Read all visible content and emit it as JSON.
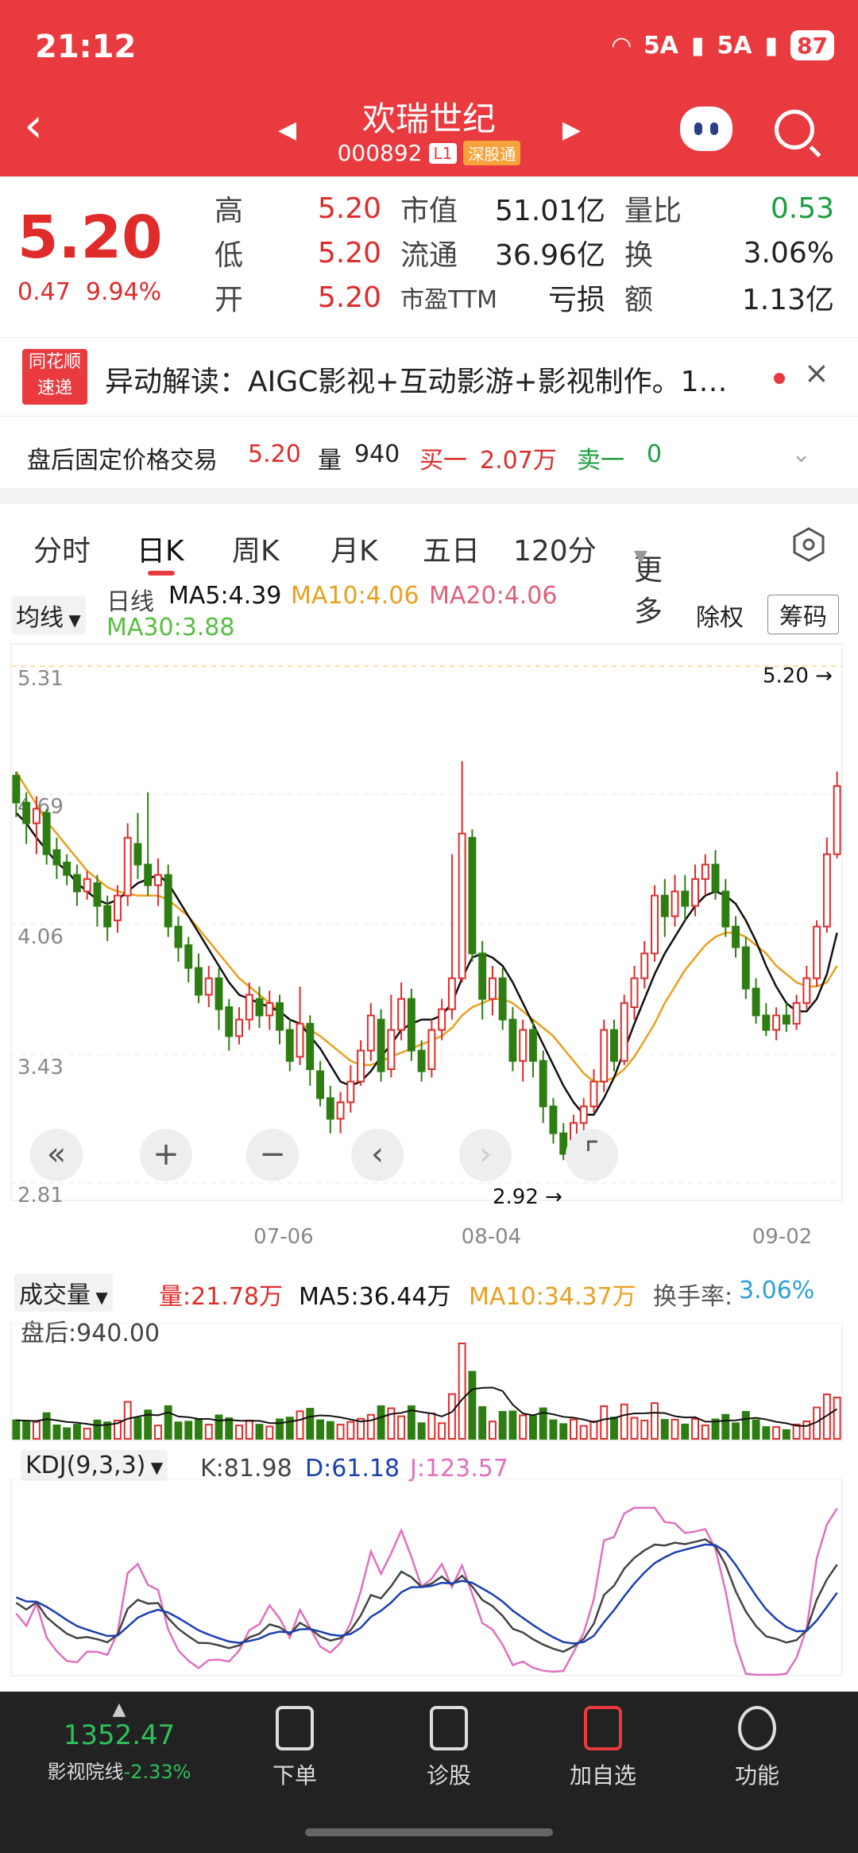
{
  "status": {
    "time": "21:12",
    "network": "5A",
    "battery": "87"
  },
  "header": {
    "name": "欢瑞世纪",
    "code": "000892",
    "level": "L1",
    "market_tag": "深股通"
  },
  "quote": {
    "price": "5.20",
    "change": "0.47",
    "change_pct": "9.94%",
    "rows": [
      [
        {
          "l": "高",
          "v": "5.20",
          "c": "red"
        },
        {
          "l": "市值",
          "v": "51.01亿"
        },
        {
          "l": "量比",
          "v": "0.53",
          "c": "green"
        }
      ],
      [
        {
          "l": "低",
          "v": "5.20",
          "c": "red"
        },
        {
          "l": "流通",
          "v": "36.96亿"
        },
        {
          "l": "换",
          "v": "3.06%"
        }
      ],
      [
        {
          "l": "开",
          "v": "5.20",
          "c": "red"
        },
        {
          "l": "市盈TTM",
          "v": "亏损"
        },
        {
          "l": "额",
          "v": "1.13亿"
        }
      ]
    ]
  },
  "banner": {
    "logo_top": "同花顺",
    "logo_bottom": "速递",
    "text": "异动解读：AIGC影视+互动影游+影视制作。1…"
  },
  "after_hours": {
    "label": "盘后固定价格交易",
    "price": "5.20",
    "vol_label": "量",
    "vol": "940",
    "buy_label": "买一",
    "buy": "2.07万",
    "sell_label": "卖一",
    "sell": "0"
  },
  "tabs": [
    "分时",
    "日K",
    "周K",
    "月K",
    "五日",
    "120分",
    "更多"
  ],
  "chart_header": {
    "ma_select": "均线",
    "period": "日线",
    "ma5": "MA5:4.39",
    "ma10": "MA10:4.06",
    "ma20": "MA20:4.06",
    "ma30": "MA30:3.88",
    "fq": "除权",
    "chips": "筹码"
  },
  "colors": {
    "up": "#e02b2b",
    "down": "#2e7d12",
    "ma5": "#111111",
    "ma10": "#e8a020",
    "ma20": "#e0607a",
    "ma30": "#55c040"
  },
  "chart_data": {
    "type": "candlestick",
    "y_ticks": [
      "5.31",
      "4.69",
      "4.06",
      "3.43",
      "2.81"
    ],
    "ylim": [
      2.81,
      5.31
    ],
    "x_ticks": [
      "07-06",
      "08-04",
      "09-02"
    ],
    "annotations": {
      "high_label": "5.20",
      "low_label": "2.92"
    },
    "candles": [
      [
        4.78,
        4.65,
        4.8,
        4.58
      ],
      [
        4.65,
        4.55,
        4.7,
        4.45
      ],
      [
        4.55,
        4.62,
        4.68,
        4.4
      ],
      [
        4.6,
        4.4,
        4.62,
        4.35
      ],
      [
        4.42,
        4.35,
        4.48,
        4.28
      ],
      [
        4.36,
        4.3,
        4.4,
        4.25
      ],
      [
        4.3,
        4.22,
        4.35,
        4.15
      ],
      [
        4.22,
        4.28,
        4.32,
        4.18
      ],
      [
        4.26,
        4.15,
        4.3,
        4.05
      ],
      [
        4.15,
        4.05,
        4.2,
        3.98
      ],
      [
        4.08,
        4.2,
        4.25,
        4.02
      ],
      [
        4.2,
        4.48,
        4.55,
        4.15
      ],
      [
        4.45,
        4.35,
        4.6,
        4.28
      ],
      [
        4.35,
        4.25,
        4.7,
        4.2
      ],
      [
        4.25,
        4.3,
        4.38,
        4.15
      ],
      [
        4.3,
        4.05,
        4.35,
        4.0
      ],
      [
        4.05,
        3.95,
        4.1,
        3.88
      ],
      [
        3.96,
        3.85,
        4.0,
        3.78
      ],
      [
        3.85,
        3.72,
        3.92,
        3.68
      ],
      [
        3.72,
        3.8,
        3.86,
        3.66
      ],
      [
        3.8,
        3.65,
        3.85,
        3.55
      ],
      [
        3.66,
        3.52,
        3.7,
        3.45
      ],
      [
        3.52,
        3.6,
        3.66,
        3.48
      ],
      [
        3.6,
        3.72,
        3.78,
        3.55
      ],
      [
        3.7,
        3.62,
        3.76,
        3.56
      ],
      [
        3.62,
        3.68,
        3.74,
        3.55
      ],
      [
        3.68,
        3.55,
        3.72,
        3.48
      ],
      [
        3.55,
        3.4,
        3.6,
        3.35
      ],
      [
        3.42,
        3.58,
        3.76,
        3.38
      ],
      [
        3.58,
        3.36,
        3.62,
        3.28
      ],
      [
        3.35,
        3.22,
        3.4,
        3.18
      ],
      [
        3.22,
        3.12,
        3.28,
        3.05
      ],
      [
        3.12,
        3.2,
        3.25,
        3.05
      ],
      [
        3.2,
        3.3,
        3.38,
        3.15
      ],
      [
        3.3,
        3.45,
        3.5,
        3.28
      ],
      [
        3.45,
        3.62,
        3.68,
        3.4
      ],
      [
        3.6,
        3.35,
        3.65,
        3.3
      ],
      [
        3.36,
        3.55,
        3.72,
        3.32
      ],
      [
        3.55,
        3.7,
        3.78,
        3.5
      ],
      [
        3.7,
        3.45,
        3.75,
        3.4
      ],
      [
        3.45,
        3.35,
        3.5,
        3.3
      ],
      [
        3.36,
        3.55,
        3.6,
        3.32
      ],
      [
        3.55,
        3.65,
        3.7,
        3.5
      ],
      [
        3.65,
        3.8,
        4.4,
        3.6
      ],
      [
        3.8,
        4.5,
        4.85,
        3.78
      ],
      [
        4.48,
        3.92,
        4.52,
        3.88
      ],
      [
        3.92,
        3.7,
        3.98,
        3.6
      ],
      [
        3.7,
        3.8,
        3.86,
        3.62
      ],
      [
        3.8,
        3.6,
        3.85,
        3.55
      ],
      [
        3.6,
        3.4,
        3.66,
        3.35
      ],
      [
        3.4,
        3.55,
        3.6,
        3.3
      ],
      [
        3.55,
        3.4,
        3.6,
        3.32
      ],
      [
        3.4,
        3.18,
        3.45,
        3.1
      ],
      [
        3.18,
        3.05,
        3.22,
        3.0
      ],
      [
        3.05,
        2.95,
        3.1,
        2.92
      ],
      [
        2.96,
        3.1,
        3.14,
        2.92
      ],
      [
        3.1,
        3.18,
        3.22,
        3.05
      ],
      [
        3.18,
        3.3,
        3.36,
        3.15
      ],
      [
        3.3,
        3.55,
        3.6,
        3.25
      ],
      [
        3.55,
        3.4,
        3.6,
        3.35
      ],
      [
        3.4,
        3.68,
        3.72,
        3.38
      ],
      [
        3.66,
        3.8,
        3.86,
        3.6
      ],
      [
        3.8,
        3.92,
        3.98,
        3.75
      ],
      [
        3.92,
        4.2,
        4.25,
        3.88
      ],
      [
        4.2,
        4.1,
        4.28,
        4.0
      ],
      [
        4.1,
        4.22,
        4.3,
        4.05
      ],
      [
        4.22,
        4.15,
        4.3,
        4.08
      ],
      [
        4.15,
        4.28,
        4.35,
        4.1
      ],
      [
        4.28,
        4.35,
        4.4,
        4.2
      ],
      [
        4.35,
        4.22,
        4.42,
        4.18
      ],
      [
        4.22,
        4.05,
        4.28,
        4.0
      ],
      [
        4.05,
        3.95,
        4.1,
        3.9
      ],
      [
        3.95,
        3.75,
        4.0,
        3.7
      ],
      [
        3.75,
        3.62,
        3.8,
        3.58
      ],
      [
        3.62,
        3.55,
        3.68,
        3.52
      ],
      [
        3.55,
        3.62,
        3.66,
        3.5
      ],
      [
        3.62,
        3.58,
        3.68,
        3.54
      ],
      [
        3.58,
        3.68,
        3.72,
        3.55
      ],
      [
        3.68,
        3.8,
        3.86,
        3.65
      ],
      [
        3.8,
        4.05,
        4.08,
        3.76
      ],
      [
        4.05,
        4.4,
        4.48,
        4.02
      ],
      [
        4.4,
        4.73,
        4.8,
        4.38
      ]
    ],
    "ma5": [
      4.6,
      4.55,
      4.48,
      4.42,
      4.36,
      4.32,
      4.26,
      4.22,
      4.18,
      4.16,
      4.18,
      4.22,
      4.26,
      4.28,
      4.3,
      4.26,
      4.18,
      4.1,
      4.02,
      3.94,
      3.86,
      3.78,
      3.72,
      3.7,
      3.68,
      3.66,
      3.64,
      3.6,
      3.58,
      3.52,
      3.46,
      3.38,
      3.3,
      3.28,
      3.3,
      3.35,
      3.42,
      3.48,
      3.55,
      3.58,
      3.6,
      3.6,
      3.62,
      3.68,
      3.8,
      3.9,
      3.92,
      3.9,
      3.86,
      3.78,
      3.68,
      3.58,
      3.48,
      3.38,
      3.28,
      3.2,
      3.14,
      3.14,
      3.22,
      3.32,
      3.45,
      3.58,
      3.7,
      3.82,
      3.92,
      4.0,
      4.08,
      4.15,
      4.2,
      4.22,
      4.2,
      4.16,
      4.08,
      3.98,
      3.86,
      3.76,
      3.68,
      3.64,
      3.64,
      3.7,
      3.82,
      4.02
    ],
    "ma10": [
      4.8,
      4.72,
      4.64,
      4.56,
      4.5,
      4.44,
      4.38,
      4.32,
      4.28,
      4.24,
      4.22,
      4.21,
      4.2,
      4.2,
      4.2,
      4.18,
      4.14,
      4.1,
      4.04,
      3.98,
      3.92,
      3.86,
      3.8,
      3.76,
      3.72,
      3.68,
      3.64,
      3.6,
      3.58,
      3.55,
      3.52,
      3.48,
      3.44,
      3.4,
      3.38,
      3.38,
      3.4,
      3.42,
      3.44,
      3.46,
      3.48,
      3.5,
      3.52,
      3.56,
      3.62,
      3.66,
      3.68,
      3.7,
      3.7,
      3.68,
      3.64,
      3.6,
      3.56,
      3.52,
      3.46,
      3.4,
      3.34,
      3.3,
      3.3,
      3.32,
      3.36,
      3.42,
      3.5,
      3.58,
      3.68,
      3.76,
      3.84,
      3.9,
      3.96,
      4.0,
      4.02,
      4.02,
      4.0,
      3.96,
      3.92,
      3.86,
      3.82,
      3.78,
      3.76,
      3.76,
      3.78,
      3.86
    ]
  },
  "volume": {
    "select": "成交量",
    "vol": "量:21.78万",
    "ma5": "MA5:36.44万",
    "ma10": "MA10:34.37万",
    "turnover_label": "换手率:",
    "turnover": "3.06%",
    "after": "盘后:940.00"
  },
  "kdj": {
    "select": "KDJ(9,3,3)",
    "k": "K:81.98",
    "d": "D:61.18",
    "j": "J:123.57"
  },
  "nav": {
    "index_value": "1352.47",
    "index_name": "影视院线",
    "index_change": "-2.33%",
    "items": [
      "下单",
      "诊股",
      "加自选",
      "功能"
    ]
  }
}
